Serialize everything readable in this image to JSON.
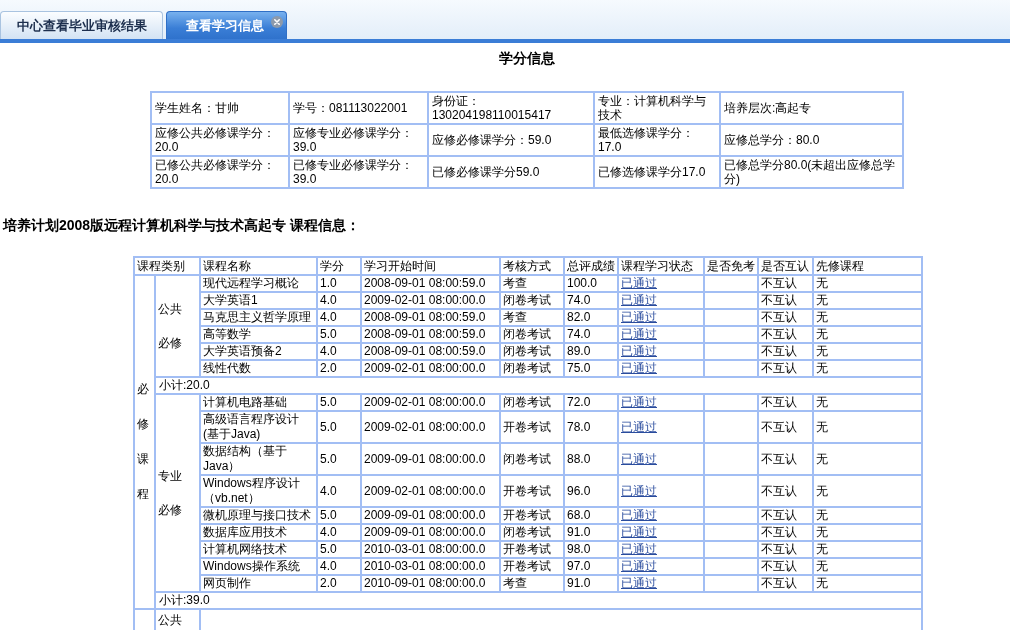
{
  "tabs": [
    {
      "label": "中心查看毕业审核结果",
      "selected": false,
      "closable": false
    },
    {
      "label": "查看学习信息",
      "selected": true,
      "closable": true
    }
  ],
  "title": "学分信息",
  "student_info": {
    "rows": [
      [
        "学生姓名：甘帅",
        "学号：081113022001",
        "身份证：130204198110015417",
        "专业：计算机科学与技术",
        "培养层次:高起专"
      ],
      [
        "应修公共必修课学分：20.0",
        "应修专业必修课学分：39.0",
        "应修必修课学分：59.0",
        "最低选修课学分：17.0",
        "应修总学分：80.0"
      ],
      [
        "已修公共必修课学分：20.0",
        "已修专业必修课学分：39.0",
        "已修必修课学分59.0",
        "已修选修课学分17.0",
        "已修总学分80.0(未超出应修总学分)"
      ]
    ]
  },
  "section_heading": "培养计划2008版远程计算机科学与技术高起专 课程信息：",
  "course_table": {
    "columns": [
      "课程类别",
      "课程名称",
      "学分",
      "学习开始时间",
      "考核方式",
      "总评成绩",
      "课程学习状态",
      "是否免考",
      "是否互认",
      "先修课程"
    ],
    "categories": [
      {
        "label": "必修课程",
        "groups": [
          {
            "label": [
              "公共",
              "必修"
            ],
            "rows": [
              {
                "name": "现代远程学习概论",
                "credits": "1.0",
                "start_time": "2008-09-01 08:00:59.0",
                "exam_type": "考查",
                "score": "100.0",
                "status": "已通过",
                "mutual_recognition": "不互认",
                "prerequisite": "无"
              },
              {
                "name": "大学英语1",
                "credits": "4.0",
                "start_time": "2009-02-01 08:00:00.0",
                "exam_type": "闭卷考试",
                "score": "74.0",
                "status": "已通过",
                "mutual_recognition": "不互认",
                "prerequisite": "无"
              },
              {
                "name": "马克思主义哲学原理",
                "credits": "4.0",
                "start_time": "2008-09-01 08:00:59.0",
                "exam_type": "考查",
                "score": "82.0",
                "status": "已通过",
                "mutual_recognition": "不互认",
                "prerequisite": "无"
              },
              {
                "name": "高等数学",
                "credits": "5.0",
                "start_time": "2008-09-01 08:00:59.0",
                "exam_type": "闭卷考试",
                "score": "74.0",
                "status": "已通过",
                "mutual_recognition": "不互认",
                "prerequisite": "无"
              },
              {
                "name": "大学英语预备2",
                "credits": "4.0",
                "start_time": "2008-09-01 08:00:59.0",
                "exam_type": "闭卷考试",
                "score": "89.0",
                "status": "已通过",
                "mutual_recognition": "不互认",
                "prerequisite": "无"
              },
              {
                "name": "线性代数",
                "credits": "2.0",
                "start_time": "2009-02-01 08:00:00.0",
                "exam_type": "闭卷考试",
                "score": "75.0",
                "status": "已通过",
                "mutual_recognition": "不互认",
                "prerequisite": "无"
              }
            ],
            "subtotal": "小计:20.0"
          },
          {
            "label": [
              "专业",
              "必修"
            ],
            "rows": [
              {
                "name": "计算机电路基础",
                "credits": "5.0",
                "start_time": "2009-02-01 08:00:00.0",
                "exam_type": "闭卷考试",
                "score": "72.0",
                "status": "已通过",
                "mutual_recognition": "不互认",
                "prerequisite": "无"
              },
              {
                "name": "高级语言程序设计(基于Java)",
                "credits": "5.0",
                "start_time": "2009-02-01 08:00:00.0",
                "exam_type": "开卷考试",
                "score": "78.0",
                "status": "已通过",
                "mutual_recognition": "不互认",
                "prerequisite": "无"
              },
              {
                "name": "数据结构（基于Java）",
                "credits": "5.0",
                "start_time": "2009-09-01 08:00:00.0",
                "exam_type": "闭卷考试",
                "score": "88.0",
                "status": "已通过",
                "mutual_recognition": "不互认",
                "prerequisite": "无"
              },
              {
                "name": "Windows程序设计（vb.net）",
                "credits": "4.0",
                "start_time": "2009-02-01 08:00:00.0",
                "exam_type": "开卷考试",
                "score": "96.0",
                "status": "已通过",
                "mutual_recognition": "不互认",
                "prerequisite": "无"
              },
              {
                "name": "微机原理与接口技术",
                "credits": "5.0",
                "start_time": "2009-09-01 08:00:00.0",
                "exam_type": "开卷考试",
                "score": "68.0",
                "status": "已通过",
                "mutual_recognition": "不互认",
                "prerequisite": "无"
              },
              {
                "name": "数据库应用技术",
                "credits": "4.0",
                "start_time": "2009-09-01 08:00:00.0",
                "exam_type": "闭卷考试",
                "score": "91.0",
                "status": "已通过",
                "mutual_recognition": "不互认",
                "prerequisite": "无"
              },
              {
                "name": "计算机网络技术",
                "credits": "5.0",
                "start_time": "2010-03-01 08:00:00.0",
                "exam_type": "开卷考试",
                "score": "98.0",
                "status": "已通过",
                "mutual_recognition": "不互认",
                "prerequisite": "无"
              },
              {
                "name": "Windows操作系统",
                "credits": "4.0",
                "start_time": "2010-03-01 08:00:00.0",
                "exam_type": "开卷考试",
                "score": "97.0",
                "status": "已通过",
                "mutual_recognition": "不互认",
                "prerequisite": "无"
              },
              {
                "name": "网页制作",
                "credits": "2.0",
                "start_time": "2010-09-01 08:00:00.0",
                "exam_type": "考查",
                "score": "91.0",
                "status": "已通过",
                "mutual_recognition": "不互认",
                "prerequisite": "无"
              }
            ],
            "subtotal": "小计:39.0"
          }
        ]
      },
      {
        "groups": [
          {
            "label": [
              "公共"
            ]
          }
        ]
      }
    ]
  }
}
